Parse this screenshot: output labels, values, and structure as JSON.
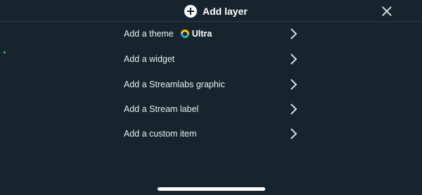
{
  "header": {
    "title": "Add layer",
    "plus_icon": "plus-circle-icon",
    "close_icon": "close-icon"
  },
  "menu": {
    "items": [
      {
        "label": "Add a theme",
        "badge": {
          "icon": "ultra-icon",
          "label": "Ultra"
        }
      },
      {
        "label": "Add a widget"
      },
      {
        "label": "Add a Streamlabs graphic"
      },
      {
        "label": "Add a Stream label"
      },
      {
        "label": "Add a custom item"
      }
    ]
  },
  "colors": {
    "background": "#17242d",
    "text": "#e9eef1",
    "accent_green": "#31c48d"
  }
}
